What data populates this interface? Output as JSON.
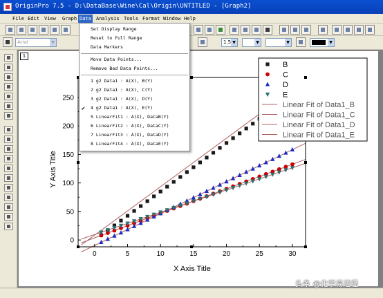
{
  "window": {
    "title": "OriginPro 7.5 - D:\\DataBase\\Wine\\Cal\\Origin\\UNTITLED - [Graph2]"
  },
  "menubar": {
    "items": [
      "File",
      "Edit",
      "View",
      "Graph",
      "Data",
      "Analysis",
      "Tools",
      "Format",
      "Window",
      "Help"
    ],
    "active": "Data"
  },
  "toolbar": {
    "font_combo": "Arial",
    "size_combo": "1.5",
    "color_swatch": "#000000"
  },
  "layer_tab": "1",
  "data_menu": {
    "set_display_range": "Set Display Range",
    "reset_to_full_range": "Reset to Full Range",
    "data_markers": "Data Markers",
    "move_data_points": "Move Data Points...",
    "remove_bad_data_points": "Remove Bad Data Points...",
    "plots": [
      {
        "label": "1 g2 Data1 : A(X), B(Y)",
        "checked": false
      },
      {
        "label": "2 g2 Data1 : A(X), C(Y)",
        "checked": false
      },
      {
        "label": "3 g2 Data1 : A(X), D(Y)",
        "checked": false
      },
      {
        "label": "4 g2 Data1 : A(X), E(Y)",
        "checked": true
      },
      {
        "label": "5     LinearFit1 : A(X), DataB(Y)",
        "checked": false
      },
      {
        "label": "6     LinearFit2 : A(X), DataC(Y)",
        "checked": false
      },
      {
        "label": "7     LinearFit3 : A(X), DataD(Y)",
        "checked": false
      },
      {
        "label": "8     LinearFit4 : A(X), DataE(Y)",
        "checked": false
      }
    ],
    "check_mark": "✔"
  },
  "chart_data": {
    "type": "scatter",
    "xlabel": "X Axis Title",
    "ylabel": "Y Axis Title",
    "xlim": [
      -2.5,
      32
    ],
    "ylim": [
      -12,
      285
    ],
    "xticks": [
      0,
      5,
      10,
      15,
      20,
      25,
      30
    ],
    "yticks": [
      0,
      50,
      100,
      150,
      200,
      250
    ],
    "x_start": 1,
    "x_step": 1,
    "series": [
      {
        "name": "B",
        "marker": "square",
        "color": "#1a1a1a",
        "values": [
          8.5,
          17,
          25.5,
          34,
          42.5,
          51,
          59.5,
          68,
          76.5,
          85,
          93.5,
          102,
          110.5,
          119,
          127.5,
          136,
          144.5,
          153,
          161.5,
          170,
          178.5,
          187,
          195.5,
          204,
          212.5
        ]
      },
      {
        "name": "C",
        "marker": "circle",
        "color": "#cc0000",
        "values": [
          8,
          12.3,
          16.6,
          20.9,
          25.2,
          29.5,
          33.8,
          38.1,
          42.4,
          46.7,
          51,
          55.3,
          59.6,
          63.9,
          68.2,
          72.5,
          76.8,
          81.1,
          85.4,
          89.7,
          94,
          98.3,
          102.6,
          106.9,
          111.2,
          115.5,
          119.8,
          124.1,
          128.4,
          132.7
        ]
      },
      {
        "name": "D",
        "marker": "triangle-up",
        "color": "#1a2bc8",
        "values": [
          -4,
          1.6,
          7.2,
          12.8,
          18.4,
          24,
          29.6,
          35.2,
          40.8,
          46.4,
          52,
          57.6,
          63.2,
          68.8,
          74.4,
          80,
          85.6,
          91.2,
          96.8,
          102.4,
          108,
          113.6,
          119.2,
          124.8,
          130.4,
          136,
          141.6,
          147.2,
          152.8,
          158.4
        ]
      },
      {
        "name": "E",
        "marker": "triangle-down",
        "color": "#2b7070",
        "values": [
          13.5,
          17.4,
          21.3,
          25.2,
          29.1,
          33,
          36.9,
          40.8,
          44.7,
          48.6,
          52.5,
          56.4,
          60.3,
          64.2,
          68.1,
          72,
          75.9,
          79.8,
          83.7,
          87.6,
          91.5,
          95.4,
          99.3,
          103.2,
          107.1,
          111,
          114.9,
          118.8,
          122.7,
          126.6
        ]
      }
    ],
    "fits": [
      {
        "name": "Linear Fit of Data1_B",
        "color": "#b06060",
        "x": [
          -2,
          25
        ],
        "y": [
          -8.5,
          221
        ]
      },
      {
        "name": "Linear Fit of Data1_C",
        "color": "#b06060",
        "x": [
          -2,
          32
        ],
        "y": [
          -4.9,
          141.3
        ]
      },
      {
        "name": "Linear Fit of Data1_D",
        "color": "#b06060",
        "x": [
          -2,
          32
        ],
        "y": [
          -20.8,
          169.6
        ]
      },
      {
        "name": "Linear Fit of Data1_E",
        "color": "#b06060",
        "x": [
          -2,
          32
        ],
        "y": [
          1.8,
          134.4
        ]
      }
    ],
    "legend": "top-right"
  }
}
